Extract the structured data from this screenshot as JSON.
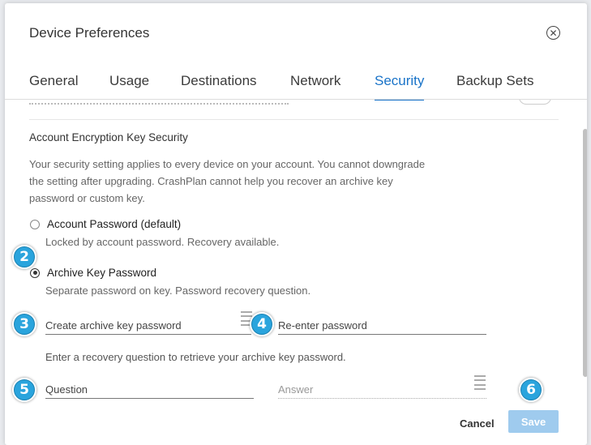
{
  "dialog": {
    "title": "Device Preferences"
  },
  "tabs": [
    {
      "label": "General",
      "active": false
    },
    {
      "label": "Usage",
      "active": false
    },
    {
      "label": "Destinations",
      "active": false
    },
    {
      "label": "Network",
      "active": false
    },
    {
      "label": "Security",
      "active": true
    },
    {
      "label": "Backup Sets",
      "active": false
    }
  ],
  "security": {
    "heading": "Account Encryption Key Security",
    "description_lines": [
      "Your security setting applies to every device on your account. You cannot downgrade",
      "the setting after upgrading. CrashPlan cannot help you recover an archive key",
      "password or custom key."
    ],
    "options": [
      {
        "label": "Account Password (default)",
        "sub": "Locked by account password. Recovery available.",
        "selected": false
      },
      {
        "label": "Archive Key Password",
        "sub": "Separate password on key. Password recovery question.",
        "selected": true
      }
    ],
    "create_password_placeholder": "Create archive key password",
    "reenter_password_placeholder": "Re-enter password",
    "recovery_info": "Enter a recovery question to retrieve your archive key password.",
    "question_placeholder": "Question",
    "answer_placeholder": "Answer"
  },
  "buttons": {
    "cancel": "Cancel",
    "save": "Save"
  },
  "callouts": [
    "2",
    "3",
    "4",
    "5",
    "6"
  ],
  "colors": {
    "accent": "#1973c8",
    "save_disabled": "#9fcbee",
    "callout": "#2aa4dd"
  }
}
